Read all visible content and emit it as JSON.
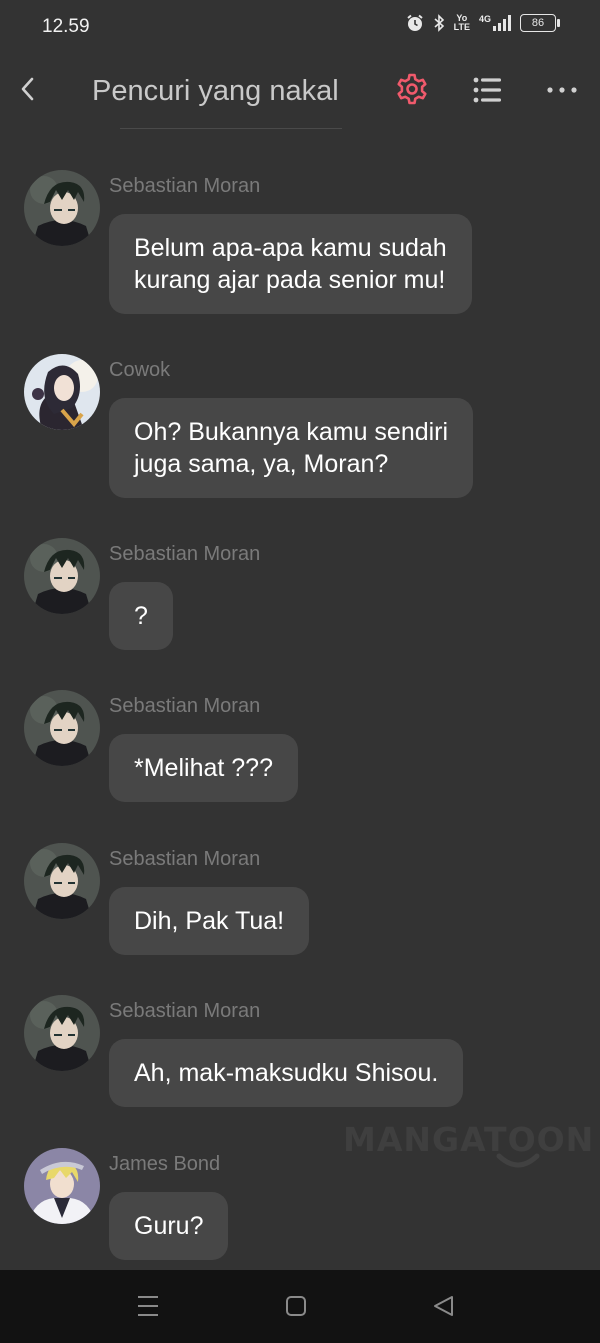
{
  "status": {
    "time": "12.59",
    "volte_top": "Yo",
    "volte_bottom": "LTE",
    "network": "4G",
    "battery": "86"
  },
  "header": {
    "title": "Pencuri yang nakal"
  },
  "colors": {
    "accent": "#f05a6c",
    "background": "#333333",
    "bubble": "#474747",
    "sender_name": "#7a7a7a"
  },
  "messages": [
    {
      "sender": "Sebastian Moran",
      "text": "Belum apa-apa kamu sudah\nkurang ajar pada senior mu!",
      "avatar": "sebastian-avatar"
    },
    {
      "sender": "Cowok",
      "text": "Oh? Bukannya kamu sendiri\njuga sama, ya, Moran?",
      "avatar": "cowok-avatar"
    },
    {
      "sender": "Sebastian Moran",
      "text": "?",
      "avatar": "sebastian-avatar"
    },
    {
      "sender": "Sebastian Moran",
      "text": "*Melihat ???",
      "avatar": "sebastian-avatar"
    },
    {
      "sender": "Sebastian Moran",
      "text": "Dih, Pak Tua!",
      "avatar": "sebastian-avatar"
    },
    {
      "sender": "Sebastian Moran",
      "text": "Ah,  mak-maksudku Shisou.",
      "avatar": "sebastian-avatar"
    },
    {
      "sender": "James Bond",
      "text": "Guru?",
      "avatar": "james-avatar"
    }
  ],
  "watermark": "MANGATOON",
  "icons": {
    "back": "chevron-left-icon",
    "settings": "gear-icon",
    "list": "list-icon",
    "more": "more-dots-icon"
  }
}
